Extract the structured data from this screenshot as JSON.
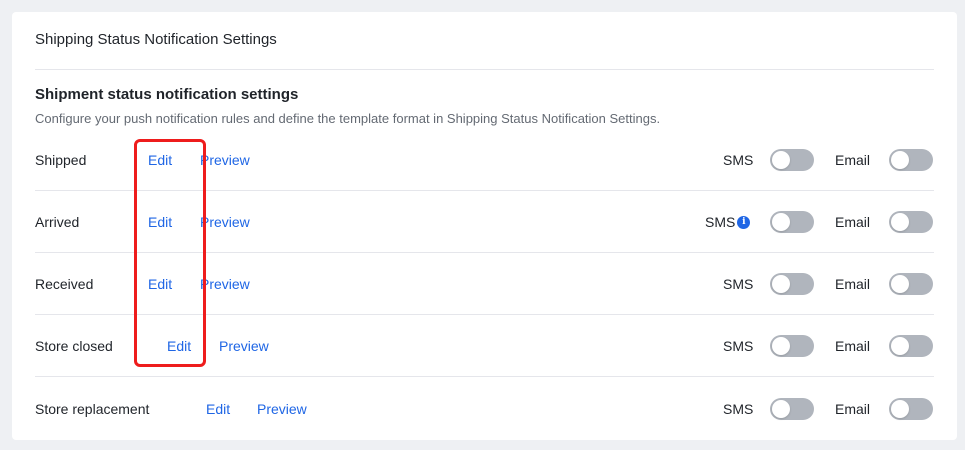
{
  "card": {
    "title": "Shipping Status Notification Settings"
  },
  "section": {
    "title": "Shipment status notification settings",
    "description": "Configure your push notification rules and define the template format in Shipping Status Notification Settings."
  },
  "rows": [
    {
      "name": "Shipped",
      "edit": "Edit",
      "preview": "Preview",
      "sms": "SMS",
      "email": "Email",
      "sms_info": false,
      "sms_enabled": false,
      "email_enabled": false
    },
    {
      "name": "Arrived",
      "edit": "Edit",
      "preview": "Preview",
      "sms": "SMS",
      "email": "Email",
      "sms_info": true,
      "sms_enabled": false,
      "email_enabled": false
    },
    {
      "name": "Received",
      "edit": "Edit",
      "preview": "Preview",
      "sms": "SMS",
      "email": "Email",
      "sms_info": false,
      "sms_enabled": false,
      "email_enabled": false
    },
    {
      "name": "Store closed",
      "edit": "Edit",
      "preview": "Preview",
      "sms": "SMS",
      "email": "Email",
      "sms_info": false,
      "sms_enabled": false,
      "email_enabled": false
    },
    {
      "name": "Store replacement",
      "edit": "Edit",
      "preview": "Preview",
      "sms": "SMS",
      "email": "Email",
      "sms_info": false,
      "sms_enabled": false,
      "email_enabled": false
    }
  ],
  "icons": {
    "info": "info-icon"
  },
  "colors": {
    "link": "#1f66e5",
    "toggle_off": "#b0b5bd",
    "highlight": "#ee1c1c"
  }
}
